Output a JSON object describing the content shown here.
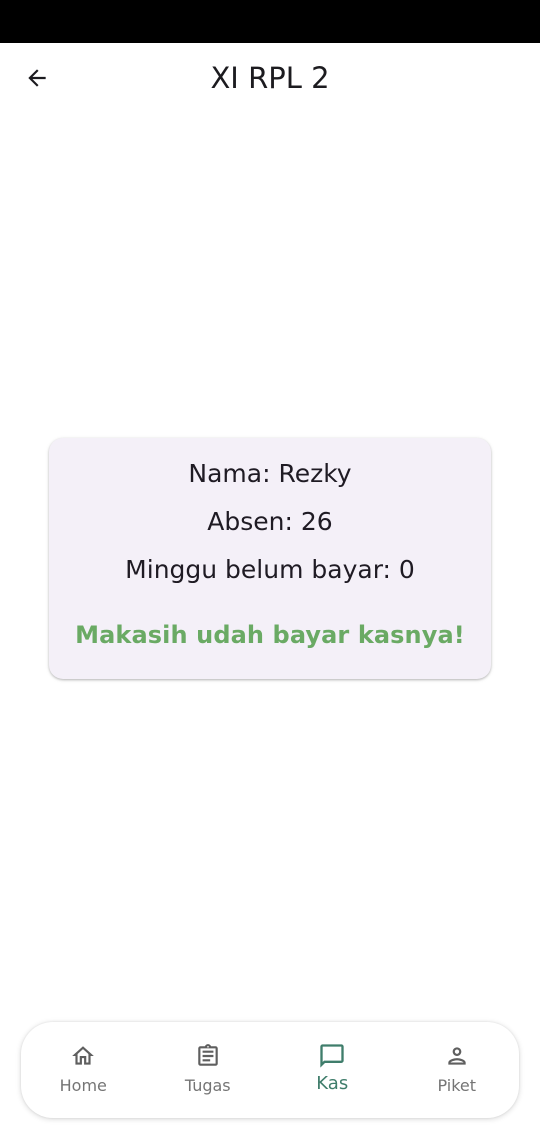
{
  "app_bar": {
    "title": "XI RPL 2",
    "back_icon": "arrow-back-icon"
  },
  "card": {
    "nama": "Nama: Rezky",
    "absen": "Absen: 26",
    "minggu": "Minggu belum bayar: 0",
    "status": "Makasih udah bayar kasnya!"
  },
  "bottom_nav": {
    "items": [
      {
        "label": "Home",
        "icon": "home-icon"
      },
      {
        "label": "Tugas",
        "icon": "clipboard-icon"
      },
      {
        "label": "Kas",
        "icon": "chat-icon"
      },
      {
        "label": "Piket",
        "icon": "person-icon"
      }
    ],
    "active": "Kas"
  },
  "colors": {
    "status_bar": "#000000",
    "card_bg": "#f4f0f8",
    "success_green": "#6aaa64",
    "nav_active": "#3f7d6b",
    "nav_inactive": "#757575"
  }
}
